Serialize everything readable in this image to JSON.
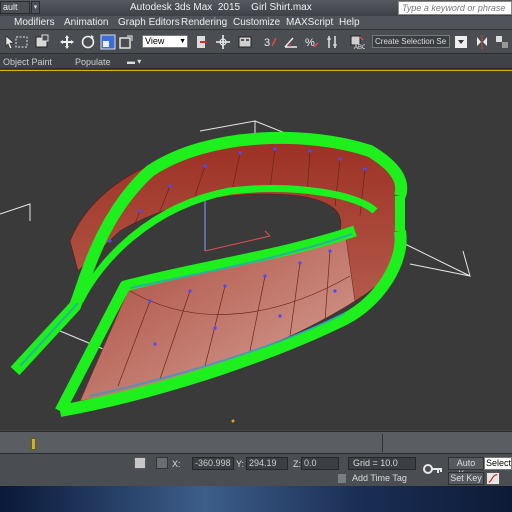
{
  "titlebar": {
    "workspace": "ault",
    "app_title": "Autodesk 3ds Max  2015    Girl Shirt.max",
    "search_placeholder": "Type a keyword or phrase"
  },
  "menubar": {
    "items": [
      "Modifiers",
      "Animation",
      "Graph Editors",
      "Rendering",
      "Customize",
      "MAXScript",
      "Help"
    ]
  },
  "toolbar": {
    "view_label": "View",
    "selection_set": "Create Selection Se"
  },
  "ribbon": {
    "tabs": [
      "Object Paint",
      "Populate"
    ]
  },
  "statusbar": {
    "x_label": "X:",
    "x_value": "-360.998",
    "y_label": "Y:",
    "y_value": "294.19",
    "z_label": "Z:",
    "z_value": "0.0",
    "grid": "Grid = 10.0",
    "add_time_tag": "Add Time Tag",
    "auto_key": "Auto Key",
    "set_key": "Set Key",
    "selected": "Selected"
  },
  "colors": {
    "accent_green": "#22ff22",
    "mesh_red": "#a04030",
    "viewport_bg": "#3a3a3a",
    "active_border": "#d8b400"
  },
  "icons": [
    "select-icon",
    "rect-select-icon",
    "move-icon",
    "rotate-icon",
    "scale-icon",
    "pivot-icon",
    "snap-icon",
    "angle-snap-icon",
    "percent-snap-icon",
    "spinner-snap-icon",
    "edit-named-sel-icon",
    "mirror-icon",
    "align-icon",
    "lock-icon",
    "key-icon"
  ]
}
